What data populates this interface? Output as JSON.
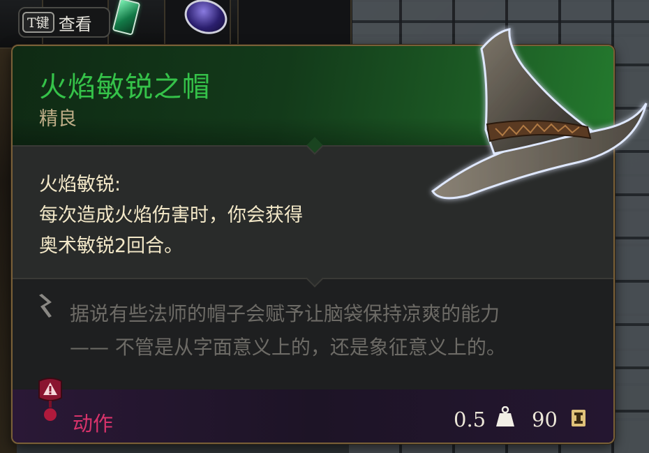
{
  "hotbar": {
    "inspect_key": "T键",
    "inspect_label": "查看"
  },
  "item": {
    "name": "火焰敏锐之帽",
    "rarity": "精良",
    "name_color": "#35c249",
    "rarity_color": "#bfae88",
    "image": "wizard-hat-icon"
  },
  "effect": {
    "title": "火焰敏锐:",
    "lines": [
      "每次造成火焰伤害时，你会获得",
      "奥术敏锐2回合。"
    ]
  },
  "flavor": {
    "lines": [
      "据说有些法师的帽子会赋予让脑袋保持凉爽的能力",
      "—— 不管是从字面意义上的，还是象征意义上的。"
    ]
  },
  "footer": {
    "action_label": "动作",
    "action_color": "#d8336b",
    "weight": "0.5",
    "price": "90"
  }
}
